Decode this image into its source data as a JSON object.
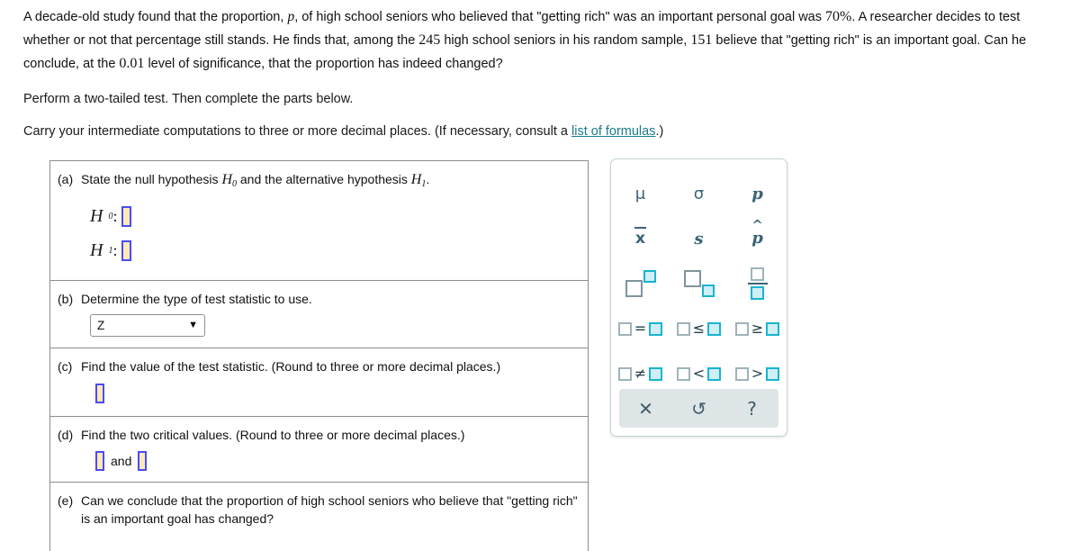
{
  "problem": {
    "line1_a": "A decade-old study found that the proportion, ",
    "var_p": "p",
    "line1_b": ", of high school seniors who believed that \"getting rich\" was an important personal goal was ",
    "pct": "70%",
    "line1_c": ". A researcher decides to test whether or not that percentage still stands. He finds that, among the ",
    "n": "245",
    "line1_d": " high school seniors in his random sample, ",
    "x": "151",
    "line1_e": " believe that \"getting rich\" is an important goal. Can he conclude, at the ",
    "alpha": "0.01",
    "line1_f": " level of significance, that the proportion has indeed changed?",
    "para2": "Perform a two-tailed test. Then complete the parts below.",
    "para3_a": "Carry your intermediate computations to three or more decimal places. (If necessary, consult a ",
    "link_text": "list of formulas",
    "para3_b": ".)"
  },
  "questions": {
    "a": {
      "label": "(a)",
      "text_1": "State the null hypothesis ",
      "h0": "H",
      "h0_sub": "0",
      "text_2": " and the alternative hypothesis ",
      "h1": "H",
      "h1_sub": "1",
      "text_3": ".",
      "row_h0_name": "H",
      "row_h0_sub": "0",
      "row_h1_name": "H",
      "row_h1_sub": "1",
      "colon": ":",
      "input_h0_value": "",
      "input_h1_value": ""
    },
    "b": {
      "label": "(b)",
      "text": "Determine the type of test statistic to use.",
      "select_value": "Z",
      "caret_icon": "chevron-down-icon"
    },
    "c": {
      "label": "(c)",
      "text": "Find the value of the test statistic. (Round to three or more decimal places.)",
      "input_value": ""
    },
    "d": {
      "label": "(d)",
      "text": "Find the two critical values. (Round to three or more decimal places.)",
      "input_lower_value": "",
      "conjunction": "and",
      "input_upper_value": ""
    },
    "e": {
      "label": "(e)",
      "text": "Can we conclude that the proportion of high school seniors who believe that \"getting rich\" is an important goal has changed?"
    }
  },
  "palette": {
    "rows": [
      [
        {
          "name": "mu-symbol",
          "glyph": "μ"
        },
        {
          "name": "sigma-symbol",
          "glyph": "σ"
        },
        {
          "name": "p-symbol",
          "glyph": "p"
        }
      ],
      [
        {
          "name": "x-bar-symbol",
          "glyph": "x"
        },
        {
          "name": "s-symbol",
          "glyph": "s"
        },
        {
          "name": "p-hat-symbol",
          "glyph": "p"
        }
      ],
      [
        {
          "name": "superscript-template",
          "glyph": ""
        },
        {
          "name": "subscript-template",
          "glyph": ""
        },
        {
          "name": "fraction-template",
          "glyph": ""
        }
      ],
      [
        {
          "name": "equals-template",
          "glyph": "="
        },
        {
          "name": "less-or-equal-template",
          "glyph": "≤"
        },
        {
          "name": "greater-or-equal-template",
          "glyph": "≥"
        }
      ],
      [
        {
          "name": "not-equal-template",
          "glyph": "≠"
        },
        {
          "name": "less-than-template",
          "glyph": "<"
        },
        {
          "name": "greater-than-template",
          "glyph": ">"
        }
      ]
    ],
    "footer": [
      {
        "name": "clear-button",
        "glyph": "✕"
      },
      {
        "name": "undo-button",
        "glyph": "↺"
      },
      {
        "name": "help-button",
        "glyph": "?"
      }
    ]
  },
  "colors": {
    "link": "#1b7b8c",
    "input_fill": "#ffe9b4",
    "input_border": "#4b4bf5",
    "palette_symbol": "#3a6476",
    "palette_cyan": "#18b4d0",
    "palette_footer_bg": "#dde5e7"
  }
}
